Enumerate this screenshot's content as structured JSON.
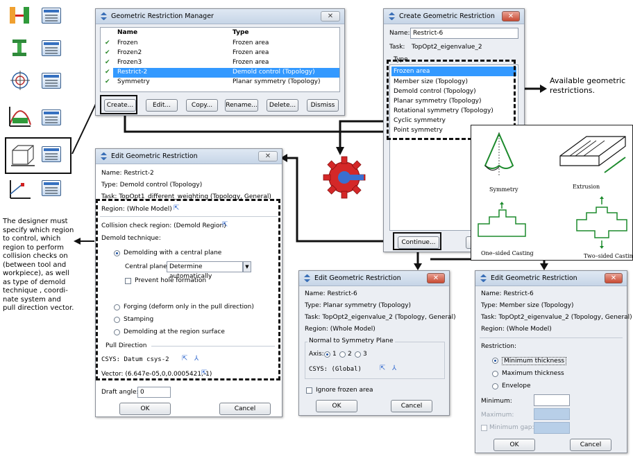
{
  "manager": {
    "title": "Geometric Restriction Manager",
    "col_name": "Name",
    "col_type": "Type",
    "rows": [
      {
        "check": "✔",
        "name": "Frozen",
        "type": "Frozen area"
      },
      {
        "check": "✔",
        "name": "Frozen2",
        "type": "Frozen area"
      },
      {
        "check": "✔",
        "name": "Frozen3",
        "type": "Frozen area"
      },
      {
        "check": "✔",
        "name": "Restrict-2",
        "type": "Demold control (Topology)"
      },
      {
        "check": "✔",
        "name": "Symmetry",
        "type": "Planar symmetry (Topology)"
      }
    ],
    "buttons": [
      "Create...",
      "Edit...",
      "Copy...",
      "Rename...",
      "Delete...",
      "Dismiss"
    ]
  },
  "create": {
    "title": "Create Geometric Restriction",
    "name_label": "Name:",
    "name_value": "Restrict-6",
    "task_label": "Task:",
    "task_value": "TopOpt2_eigenvalue_2",
    "type_label": "Type",
    "types": [
      "Frozen area",
      "Member size (Topology)",
      "Demold control (Topology)",
      "Planar symmetry (Topology)",
      "Rotational symmetry (Topology)",
      "Cyclic symmetry",
      "Point symmetry"
    ],
    "continue_label": "Continue..."
  },
  "annot_right": "Available geometric\nrestrictions.",
  "annot_left": "The designer must\nspecify which region\nto control, which\nregion to perform\ncollision checks on\n(between tool and\nworkpiece), as well\nas type of demold\ntechnique , coordi-\nnate system and\npull direction vector.",
  "shapes": {
    "symmetry": "Symmetry",
    "extrusion": "Extrusion",
    "one_sided": "One–sided Casting",
    "two_sided": "Two–sided Casting"
  },
  "edit_demold": {
    "title": "Edit Geometric Restriction",
    "name": "Name:  Restrict-2",
    "type": "Type:    Demold control (Topology)",
    "task": "Task:    TopOpt1_different_weighting (Topology, General)",
    "region": "Region:  (Whole Model)",
    "collision": "Collision check region:  (Demold Region)",
    "technique": "Demold technique:",
    "opt_central": "Demolding with a central plane",
    "central_plane_label": "Central plane:",
    "central_plane_value": "Determine automatically",
    "prevent_hole": "Prevent hole formation",
    "opt_forging": "Forging (deform only in the pull direction)",
    "opt_stamping": "Stamping",
    "opt_surface": "Demolding at the region surface",
    "pull_direction": "Pull Direction",
    "csys": "CSYS:  Datum csys-2",
    "vector": "Vector:  (6.647e-05,0,0.0005421,-1)",
    "draft_label": "Draft angle:",
    "draft_value": "0",
    "ok": "OK",
    "cancel": "Cancel"
  },
  "edit_planar": {
    "title": "Edit Geometric Restriction",
    "name": "Name:  Restrict-6",
    "type": "Type:    Planar symmetry (Topology)",
    "task": "Task:    TopOpt2_eigenvalue_2 (Topology, General)",
    "region": "Region:  (Whole Model)",
    "normal": "Normal to Symmetry Plane",
    "axis_label": "Axis:",
    "axes": [
      "1",
      "2",
      "3"
    ],
    "csys": "CSYS:  (Global)",
    "ignore": "Ignore frozen area",
    "ok": "OK",
    "cancel": "Cancel"
  },
  "edit_member": {
    "title": "Edit Geometric Restriction",
    "name": "Name:  Restrict-6",
    "type": "Type:    Member size (Topology)",
    "task": "Task:    TopOpt2_eigenvalue_2 (Topology, General)",
    "region": "Region:  (Whole Model)",
    "restriction": "Restriction:",
    "opt_min": "Minimum thickness",
    "opt_max": "Maximum thickness",
    "opt_env": "Envelope",
    "minimum": "Minimum:",
    "maximum": "Maximum:",
    "min_gap": "Minimum gap:",
    "ok": "OK",
    "cancel": "Cancel"
  }
}
